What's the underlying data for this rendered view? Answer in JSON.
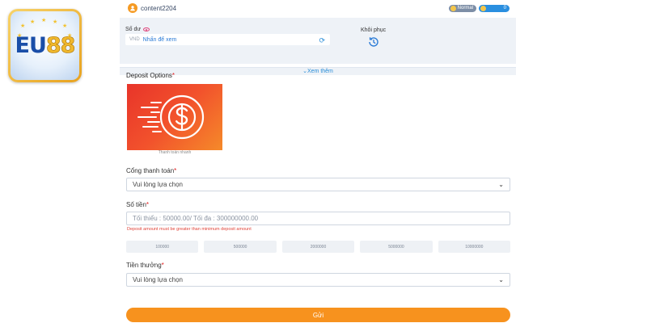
{
  "brand": {
    "logo_text_eu": "EU",
    "logo_text_num": "88",
    "logo_name": "eu88-logo"
  },
  "user": {
    "username": "content2204",
    "level": "Normal",
    "coins": "0"
  },
  "balance": {
    "label": "Số dư",
    "currency": "VND",
    "hint": "Nhấn để xem",
    "restore_label": "Khôi phục",
    "more_label": "Xem thêm"
  },
  "deposit": {
    "title": "Deposit Options",
    "option_caption": "Thanh toán nhanh"
  },
  "gateway": {
    "label": "Cổng thanh toán",
    "placeholder": "Vui lòng lựa chọn"
  },
  "amount": {
    "label": "Số tiền",
    "placeholder": "Tối thiểu : 50000.00/ Tối đa : 300000000.00",
    "error": "Deposit amount must be greater than minimum deposit amount",
    "presets": [
      "100000",
      "500000",
      "2000000",
      "5000000",
      "10000000"
    ]
  },
  "bonus": {
    "label": "Tiền thưởng",
    "placeholder": "Vui lòng lựa chọn"
  },
  "submit_label": "Gửi",
  "colors": {
    "accent": "#f7921e",
    "link": "#2b8ed8",
    "error": "#e0443a",
    "panel": "#eef2f7"
  }
}
